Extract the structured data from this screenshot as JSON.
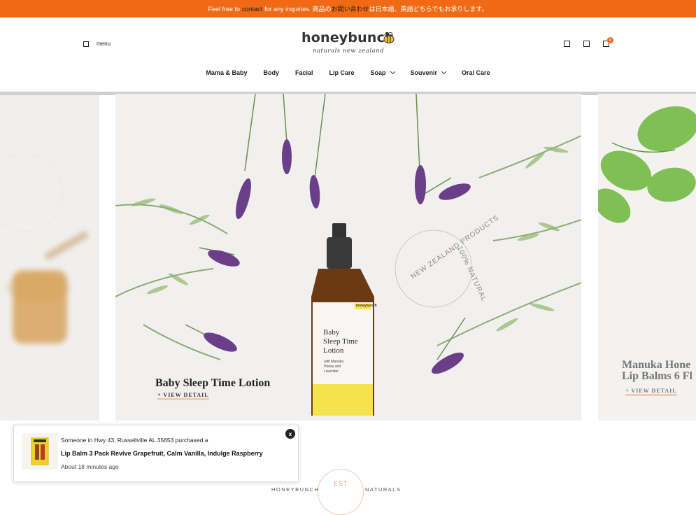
{
  "announcement": {
    "prefix": "Feel free to",
    "link": "contact",
    "middle": "for any inquiries. 商品の",
    "link2": "お問い合わせ",
    "suffix": "は日本語、英語どちらでもお承りします。"
  },
  "header": {
    "menu_label": "menu",
    "logo_text": "honeybunch",
    "logo_sub": "naturals new zealand",
    "cart_count": "0"
  },
  "nav": {
    "items": [
      {
        "label": "Mama & Baby"
      },
      {
        "label": "Body"
      },
      {
        "label": "Facial"
      },
      {
        "label": "Lip Care"
      },
      {
        "label": "Soap"
      },
      {
        "label": "Souvenir"
      },
      {
        "label": "Oral Care"
      }
    ]
  },
  "slides": {
    "main_title": "Baby Sleep Time Lotion",
    "main_link": "+ VIEW DETAIL",
    "right_title_1": "Manuka Hone",
    "right_title_2": "Lip Balms 6 Fl",
    "right_link": "+ VIEW DETAIL",
    "stamp_top": "NEW ZEALAND PRODUCTS",
    "stamp_bottom": "100% NATURAL",
    "bottle_brand": "honeybunch",
    "bottle_line1": "Baby",
    "bottle_line2": "Sleep Time",
    "bottle_line3": "Lotion",
    "bottle_small1": "with Manuka",
    "bottle_small2": "Honey and",
    "bottle_small3": "Lavender"
  },
  "popup": {
    "line1": "Someone in Hwy 43, Russellville AL 35653 purchased a",
    "line2": "Lip Balm 3 Pack Revive Grapefruit, Calm Vanilla, Indulge Raspberry",
    "line3": "About 18 minutes ago",
    "close": "x"
  },
  "footer": {
    "left": "HONEYBUNCH",
    "est": "EST",
    "right": "NATURALS"
  },
  "colors": {
    "accent": "#f06a16",
    "underline": "#f5c8b4"
  }
}
